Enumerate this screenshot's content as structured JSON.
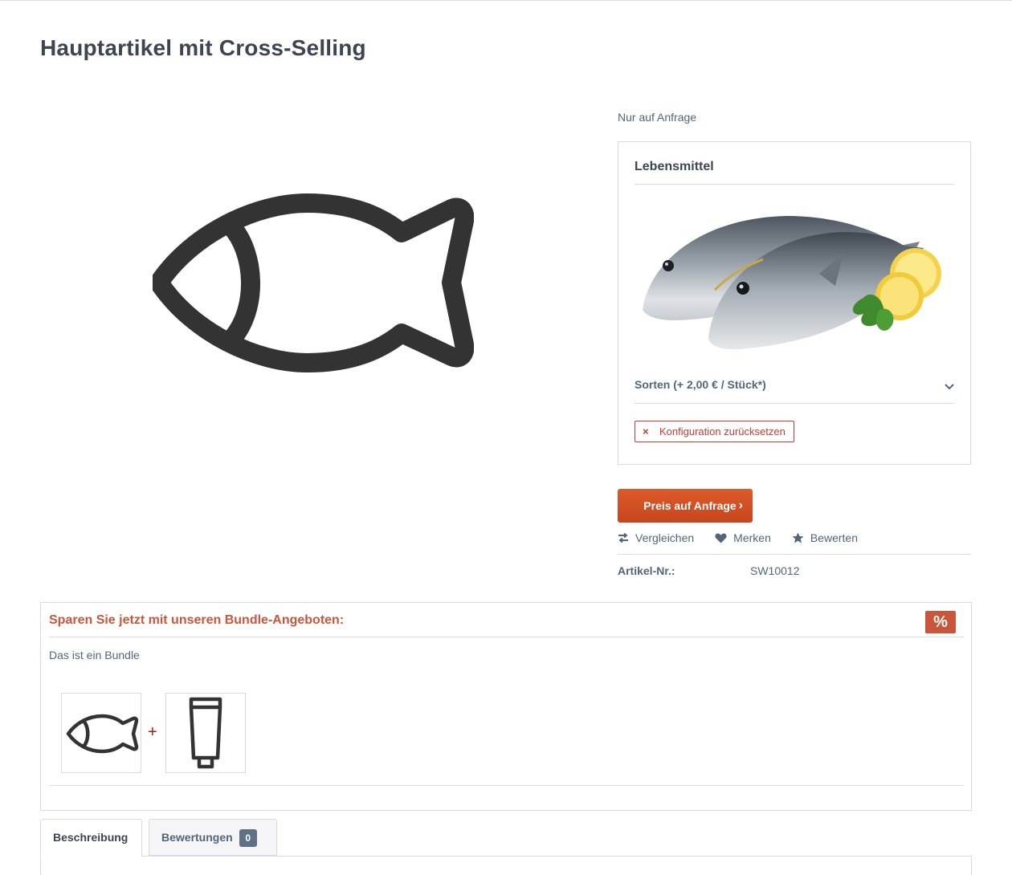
{
  "page": {
    "title": "Hauptartikel mit Cross-Selling"
  },
  "product": {
    "availability": "Nur auf Anfrage",
    "main_image_icon": "fish-icon",
    "config": {
      "heading": "Lebensmittel",
      "image_alt": "fish-photo",
      "option_label": "Sorten (+ 2,00 € / Stück*)",
      "reset_label": "Konfiguration zurücksetzen"
    },
    "buy_button_label": "Preis auf Anfrage",
    "actions": [
      {
        "label": "Vergleichen",
        "icon": "compare-icon"
      },
      {
        "label": "Merken",
        "icon": "heart-icon"
      },
      {
        "label": "Bewerten",
        "icon": "star-icon"
      }
    ],
    "article_number_label": "Artikel-Nr.:",
    "article_number": "SW10012"
  },
  "bundle": {
    "heading": "Sparen Sie jetzt mit unseren Bundle-Angeboten:",
    "badge": "%",
    "description": "Das ist ein Bundle",
    "plus": "+",
    "items": [
      {
        "icon": "fish-icon"
      },
      {
        "icon": "tube-icon"
      }
    ]
  },
  "tabs": [
    {
      "label": "Beschreibung",
      "active": true
    },
    {
      "label": "Bewertungen",
      "count": "0",
      "active": false
    }
  ],
  "colors": {
    "accent": "#c9553a",
    "buy_button": "#d0501f",
    "text": "#52667a",
    "border": "#dadae5"
  }
}
